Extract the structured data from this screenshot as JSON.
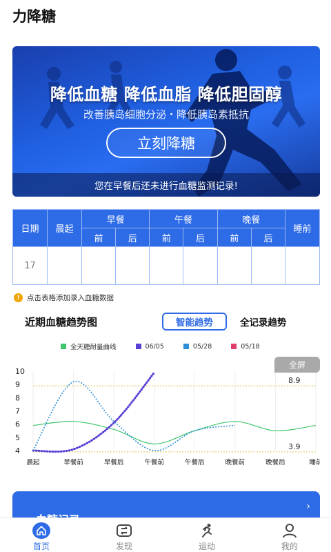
{
  "app_title": "力降糖",
  "banner": {
    "headline": "降低血糖 降低血脂 降低胆固醇",
    "subtitle": "改善胰岛细胞分泌・降低胰岛素抵抗",
    "button_label": "立刻降糖",
    "notice": "您在早餐后还未进行血糖监测记录!"
  },
  "table": {
    "header_date": "日期",
    "header_wake": "晨起",
    "meals": [
      "早餐",
      "午餐",
      "晚餐"
    ],
    "header_before": "前",
    "header_after": "后",
    "header_sleep": "睡前",
    "row_date": "17"
  },
  "hint": {
    "icon": "info-icon",
    "text": "点击表格添加录入血糖数据"
  },
  "trend": {
    "title": "近期血糖趋势图",
    "tab_smart": "智能趋势",
    "tab_all": "全记录趋势",
    "fullscreen": "全屏"
  },
  "chart_data": {
    "type": "line",
    "categories": [
      "晨起",
      "早餐前",
      "早餐后",
      "午餐前",
      "午餐后",
      "晚餐前",
      "晚餐后",
      "睡前"
    ],
    "y_ticks": [
      4,
      5,
      6,
      7,
      8,
      9,
      10
    ],
    "ylim": [
      4,
      10
    ],
    "reference_lines": [
      8.9,
      3.9
    ],
    "reference_labels": [
      "8.9",
      "3.9"
    ],
    "series": [
      {
        "name": "全天糖耐量曲线",
        "color": "#3ec46d",
        "style": "solid",
        "values": [
          5.9,
          6.2,
          5.6,
          4.5,
          5.5,
          6.2,
          5.5,
          5.9
        ]
      },
      {
        "name": "06/05",
        "color": "#5a3fd6",
        "style": "dotted",
        "values": [
          4.0,
          4.1,
          6.1,
          9.9,
          null,
          null,
          null,
          null
        ]
      },
      {
        "name": "05/28",
        "color": "#2e8fd9",
        "style": "dotted-solid",
        "values": [
          4.0,
          9.2,
          6.2,
          4.0,
          5.5,
          5.9,
          null,
          null
        ]
      },
      {
        "name": "05/18",
        "color": "#e03d6a",
        "style": "solid",
        "values": []
      }
    ]
  },
  "record_card": {
    "label": "血糖记录",
    "chevron": "›"
  },
  "bottom_nav": [
    {
      "label": "首页",
      "icon": "home-icon",
      "active": true
    },
    {
      "label": "发现",
      "icon": "discover-icon",
      "active": false
    },
    {
      "label": "运动",
      "icon": "run-icon",
      "active": false
    },
    {
      "label": "我的",
      "icon": "user-icon",
      "active": false
    }
  ],
  "colors": {
    "primary": "#2e6be6",
    "ref_line": "#d8c44a"
  }
}
